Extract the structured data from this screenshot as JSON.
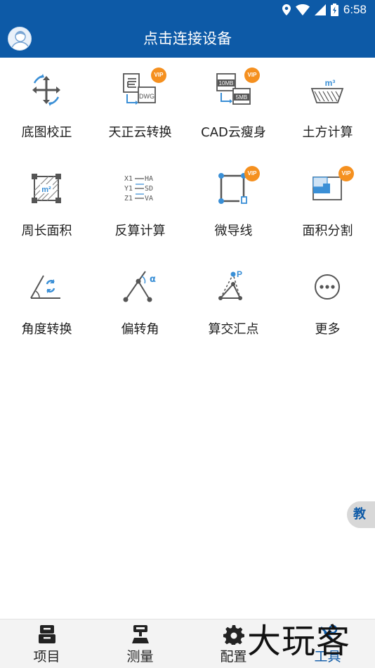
{
  "status_bar": {
    "time": "6:58",
    "icons": [
      "location-icon",
      "wifi-icon",
      "signal-icon",
      "battery-icon"
    ]
  },
  "header": {
    "title": "点击连接设备"
  },
  "tools": [
    {
      "id": "base-map-calibrate",
      "label": "底图校正",
      "icon": "move-rotate-icon",
      "vip": false
    },
    {
      "id": "tianzheng-cloud-convert",
      "label": "天正云转换",
      "icon": "dwg-convert-icon",
      "vip": true
    },
    {
      "id": "cad-cloud-slim",
      "label": "CAD云瘦身",
      "icon": "file-size-icon",
      "vip": true
    },
    {
      "id": "earthwork-calc",
      "label": "土方计算",
      "icon": "volume-icon",
      "vip": false
    },
    {
      "id": "perimeter-area",
      "label": "周长面积",
      "icon": "area-icon",
      "vip": false
    },
    {
      "id": "inverse-calc",
      "label": "反算计算",
      "icon": "inverse-calc-icon",
      "vip": false
    },
    {
      "id": "micro-guide-line",
      "label": "微导线",
      "icon": "traverse-icon",
      "vip": true
    },
    {
      "id": "area-split",
      "label": "面积分割",
      "icon": "area-split-icon",
      "vip": true
    },
    {
      "id": "angle-convert",
      "label": "角度转换",
      "icon": "angle-convert-icon",
      "vip": false
    },
    {
      "id": "deflection-angle",
      "label": "偏转角",
      "icon": "deflection-icon",
      "vip": false
    },
    {
      "id": "intersection-point",
      "label": "算交汇点",
      "icon": "intersection-icon",
      "vip": false
    },
    {
      "id": "more",
      "label": "更多",
      "icon": "more-icon",
      "vip": false
    }
  ],
  "vip_label": "VIP",
  "inverse_icon_text": {
    "r1": "X1",
    "r1b": "HA",
    "r2": "Y1",
    "r2b": "SD",
    "r3": "Z1",
    "r3b": "VA"
  },
  "dwg_icon_text": "DWG",
  "size_icon_text": {
    "from": "10MB",
    "to": "5MB"
  },
  "volume_icon_text": "m³",
  "area_icon_text": "m²",
  "deflection_icon_text": "α",
  "intersection_icon_text": "P",
  "side_pull": {
    "label": "教"
  },
  "tabs": [
    {
      "label": "项目",
      "icon": "project-icon",
      "active": false
    },
    {
      "label": "测量",
      "icon": "survey-icon",
      "active": false
    },
    {
      "label": "配置",
      "icon": "gear-icon",
      "active": false
    },
    {
      "label": "工具",
      "icon": "tools-icon",
      "active": true
    }
  ],
  "colors": {
    "primary": "#0d5aa7",
    "accent_blue": "#3a8fd6",
    "vip_orange": "#f5901f",
    "icon_gray": "#555555"
  },
  "watermark": "大玩客"
}
